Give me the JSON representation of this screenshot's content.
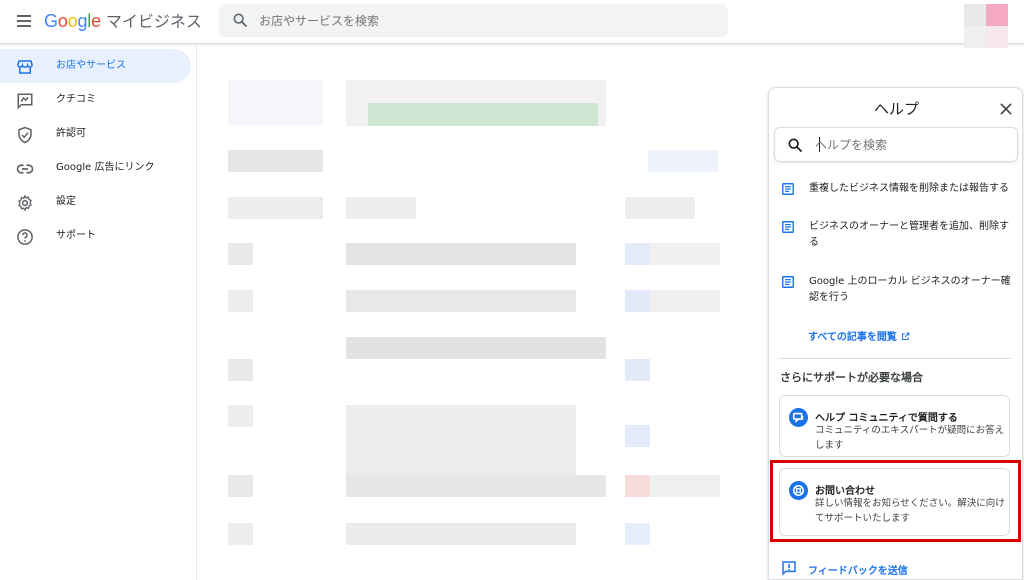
{
  "header": {
    "logo_google": "Google",
    "logo_product": "マイビジネス",
    "search_placeholder": "お店やサービスを検索"
  },
  "sidebar": {
    "items": [
      {
        "label": "お店やサービス",
        "icon": "storefront-icon",
        "active": true
      },
      {
        "label": "クチコミ",
        "icon": "review-icon",
        "active": false
      },
      {
        "label": "許認可",
        "icon": "verified-shield-icon",
        "active": false
      },
      {
        "label": "Google 広告にリンク",
        "icon": "link-icon",
        "active": false
      },
      {
        "label": "設定",
        "icon": "gear-icon",
        "active": false
      },
      {
        "label": "サポート",
        "icon": "help-circle-icon",
        "active": false
      }
    ]
  },
  "help": {
    "title": "ヘルプ",
    "search_placeholder": "ヘルプを検索",
    "articles": [
      {
        "text": "重複したビジネス情報を削除または報告する"
      },
      {
        "text": "ビジネスのオーナーと管理者を追加、削除する"
      },
      {
        "text": "Google 上のローカル ビジネスのオーナー確認を行う"
      }
    ],
    "all_articles_link": "すべての記事を閲覧",
    "more_support_title": "さらにサポートが必要な場合",
    "cards": [
      {
        "title": "ヘルプ コミュニティで質問する",
        "desc": "コミュニティのエキスパートが疑問にお答えします"
      },
      {
        "title": "お問い合わせ",
        "desc": "詳しい情報をお知らせください。解決に向けてサポートいたします"
      }
    ],
    "feedback": "フィードバックを送信"
  },
  "colors": {
    "accent": "#1a73e8",
    "highlight": "#d50000",
    "active_nav_bg": "#e8f0fe"
  }
}
